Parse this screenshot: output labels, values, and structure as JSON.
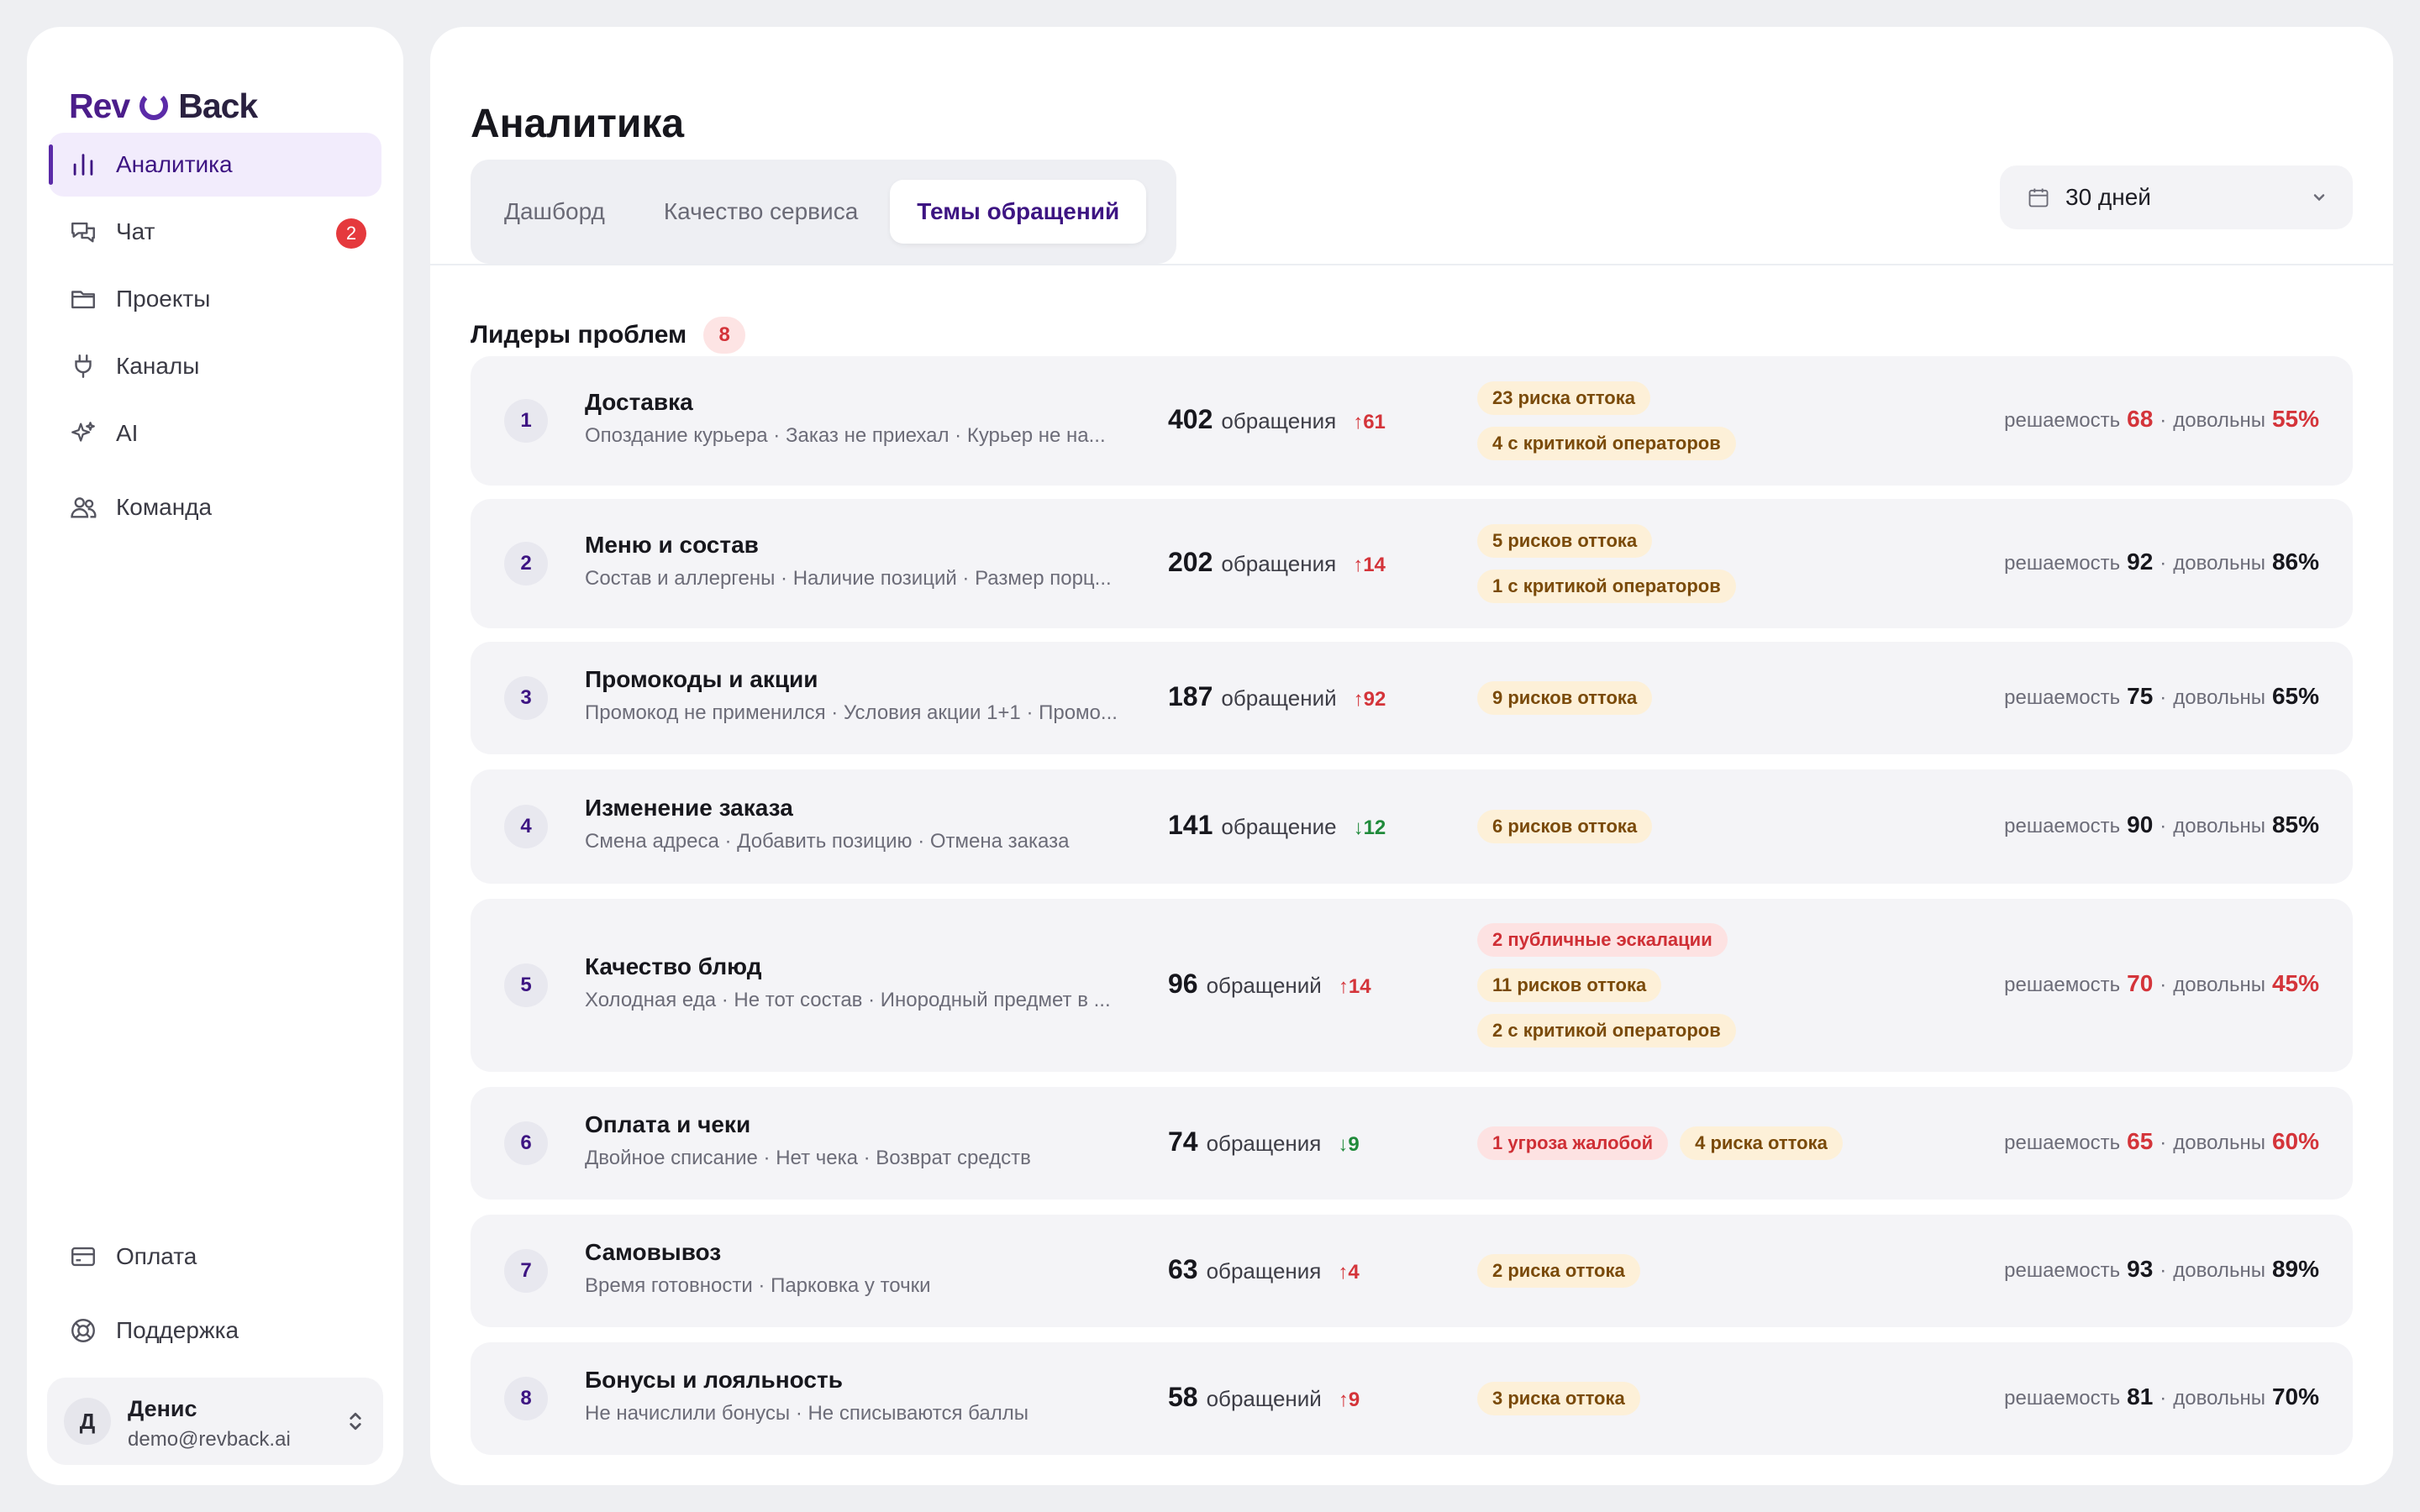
{
  "brand": {
    "part1": "Rev",
    "part2": "Back"
  },
  "nav": {
    "analytics": "Аналитика",
    "chat": "Чат",
    "chat_badge": "2",
    "projects": "Проекты",
    "channels": "Каналы",
    "ai": "AI",
    "team": "Команда",
    "billing": "Оплата",
    "support": "Поддержка"
  },
  "user": {
    "initial": "Д",
    "name": "Денис",
    "email": "demo@revback.ai"
  },
  "page": {
    "title": "Аналитика"
  },
  "tabs": [
    "Дашборд",
    "Качество сервиса",
    "Темы обращений"
  ],
  "period": {
    "label": "30 дней"
  },
  "section": {
    "title": "Лидеры проблем",
    "count": "8"
  },
  "labels": {
    "resolvability": "решаемость",
    "sep": "·",
    "satisfied": "довольны"
  },
  "colors": {
    "accent": "#3d1482",
    "danger": "#d4343a",
    "success": "#1f8a3a"
  },
  "topics": [
    {
      "rank": "1",
      "name": "Доставка",
      "sub": "Опоздание курьера · Заказ не приехал · Курьер не на...",
      "count": "402",
      "unit": "обращения",
      "delta": "↑61",
      "dir": "up",
      "tags": [
        {
          "text": "23 риска оттока",
          "kind": "churn"
        },
        {
          "text": "4 с критикой операторов",
          "kind": "churn"
        }
      ],
      "resolvability": "68",
      "res_bad": true,
      "satisfied": "55%",
      "sat_bad": true
    },
    {
      "rank": "2",
      "name": "Меню и состав",
      "sub": "Состав и аллергены · Наличие позиций · Размер порц...",
      "count": "202",
      "unit": "обращения",
      "delta": "↑14",
      "dir": "up",
      "tags": [
        {
          "text": "5 рисков оттока",
          "kind": "churn"
        },
        {
          "text": "1 с критикой операторов",
          "kind": "churn"
        }
      ],
      "resolvability": "92",
      "res_bad": false,
      "satisfied": "86%",
      "sat_bad": false
    },
    {
      "rank": "3",
      "name": "Промокоды и акции",
      "sub": "Промокод не применился · Условия акции 1+1 · Промо...",
      "count": "187",
      "unit": "обращений",
      "delta": "↑92",
      "dir": "up",
      "tags": [
        {
          "text": "9 рисков оттока",
          "kind": "churn"
        }
      ],
      "resolvability": "75",
      "res_bad": false,
      "satisfied": "65%",
      "sat_bad": false
    },
    {
      "rank": "4",
      "name": "Изменение заказа",
      "sub": "Смена адреса · Добавить позицию · Отмена заказа",
      "count": "141",
      "unit": "обращение",
      "delta": "↓12",
      "dir": "down",
      "tags": [
        {
          "text": "6 рисков оттока",
          "kind": "churn"
        }
      ],
      "resolvability": "90",
      "res_bad": false,
      "satisfied": "85%",
      "sat_bad": false
    },
    {
      "rank": "5",
      "name": "Качество блюд",
      "sub": "Холодная еда · Не тот состав · Инородный предмет в ...",
      "count": "96",
      "unit": "обращений",
      "delta": "↑14",
      "dir": "up",
      "tags": [
        {
          "text": "2 публичные эскалации",
          "kind": "alert"
        },
        {
          "text": "11 рисков оттока",
          "kind": "churn"
        },
        {
          "text": "2 с критикой операторов",
          "kind": "churn"
        }
      ],
      "resolvability": "70",
      "res_bad": true,
      "satisfied": "45%",
      "sat_bad": true
    },
    {
      "rank": "6",
      "name": "Оплата и чеки",
      "sub": "Двойное списание · Нет чека · Возврат средств",
      "count": "74",
      "unit": "обращения",
      "delta": "↓9",
      "dir": "down",
      "tags": [
        {
          "text": "1 угроза жалобой",
          "kind": "alert"
        },
        {
          "text": "4 риска оттока",
          "kind": "churn"
        }
      ],
      "resolvability": "65",
      "res_bad": true,
      "satisfied": "60%",
      "sat_bad": true
    },
    {
      "rank": "7",
      "name": "Самовывоз",
      "sub": "Время готовности · Парковка у точки",
      "count": "63",
      "unit": "обращения",
      "delta": "↑4",
      "dir": "up",
      "tags": [
        {
          "text": "2 риска оттока",
          "kind": "churn"
        }
      ],
      "resolvability": "93",
      "res_bad": false,
      "satisfied": "89%",
      "sat_bad": false
    },
    {
      "rank": "8",
      "name": "Бонусы и лояльность",
      "sub": "Не начислили бонусы · Не списываются баллы",
      "count": "58",
      "unit": "обращений",
      "delta": "↑9",
      "dir": "up",
      "tags": [
        {
          "text": "3 риска оттока",
          "kind": "churn"
        }
      ],
      "resolvability": "81",
      "res_bad": false,
      "satisfied": "70%",
      "sat_bad": false
    }
  ]
}
